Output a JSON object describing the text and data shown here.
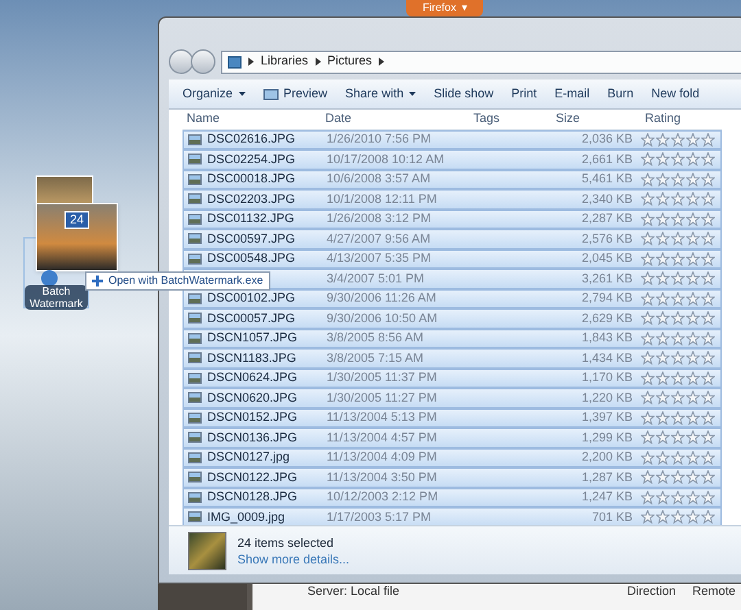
{
  "taskbar_button": {
    "label": "Firefox",
    "caret": "▾"
  },
  "breadcrumb": [
    "Libraries",
    "Pictures"
  ],
  "toolbar": [
    {
      "label": "Organize",
      "dropdown": true,
      "kind": "menu"
    },
    {
      "label": "Preview",
      "dropdown": false,
      "kind": "icon"
    },
    {
      "label": "Share with",
      "dropdown": true,
      "kind": "menu"
    },
    {
      "label": "Slide show",
      "dropdown": false,
      "kind": "plain"
    },
    {
      "label": "Print",
      "dropdown": false,
      "kind": "plain"
    },
    {
      "label": "E-mail",
      "dropdown": false,
      "kind": "plain"
    },
    {
      "label": "Burn",
      "dropdown": false,
      "kind": "plain"
    },
    {
      "label": "New fold",
      "dropdown": false,
      "kind": "plain"
    }
  ],
  "table": {
    "columns": [
      "Name",
      "Date",
      "Tags",
      "Size",
      "Rating"
    ],
    "rows": [
      {
        "name": "DSC02616.JPG",
        "date": "1/26/2010 7:56 PM",
        "size": "2,036 KB",
        "stars": 0,
        "selected": true
      },
      {
        "name": "DSC02254.JPG",
        "date": "10/17/2008 10:12 AM",
        "size": "2,661 KB",
        "stars": 0,
        "selected": true
      },
      {
        "name": "DSC00018.JPG",
        "date": "10/6/2008 3:57 AM",
        "size": "5,461 KB",
        "stars": 0,
        "selected": true
      },
      {
        "name": "DSC02203.JPG",
        "date": "10/1/2008 12:11 PM",
        "size": "2,340 KB",
        "stars": 0,
        "selected": true
      },
      {
        "name": "DSC01132.JPG",
        "date": "1/26/2008 3:12 PM",
        "size": "2,287 KB",
        "stars": 0,
        "selected": true
      },
      {
        "name": "DSC00597.JPG",
        "date": "4/27/2007 9:56 AM",
        "size": "2,576 KB",
        "stars": 0,
        "selected": true
      },
      {
        "name": "DSC00548.JPG",
        "date": "4/13/2007 5:35 PM",
        "size": "2,045 KB",
        "stars": 0,
        "selected": true
      },
      {
        "date": "3/4/2007 5:01 PM",
        "size": "3,261 KB",
        "stars": 0,
        "selected": true
      },
      {
        "name": "DSC00102.JPG",
        "date": "9/30/2006 11:26 AM",
        "size": "2,794 KB",
        "stars": 0,
        "selected": true
      },
      {
        "name": "DSC00057.JPG",
        "date": "9/30/2006 10:50 AM",
        "size": "2,629 KB",
        "stars": 0,
        "selected": true
      },
      {
        "name": "DSCN1057.JPG",
        "date": "3/8/2005 8:56 AM",
        "size": "1,843 KB",
        "stars": 0,
        "selected": true
      },
      {
        "name": "DSCN1183.JPG",
        "date": "3/8/2005 7:15 AM",
        "size": "1,434 KB",
        "stars": 0,
        "selected": true
      },
      {
        "name": "DSCN0624.JPG",
        "date": "1/30/2005 11:37 PM",
        "size": "1,170 KB",
        "stars": 0,
        "selected": true
      },
      {
        "name": "DSCN0620.JPG",
        "date": "1/30/2005 11:27 PM",
        "size": "1,220 KB",
        "stars": 0,
        "selected": true
      },
      {
        "name": "DSCN0152.JPG",
        "date": "11/13/2004 5:13 PM",
        "size": "1,397 KB",
        "stars": 0,
        "selected": true
      },
      {
        "name": "DSCN0136.JPG",
        "date": "11/13/2004 4:57 PM",
        "size": "1,299 KB",
        "stars": 0,
        "selected": true
      },
      {
        "name": "DSCN0127.jpg",
        "date": "11/13/2004 4:09 PM",
        "size": "2,200 KB",
        "stars": 0,
        "selected": true
      },
      {
        "name": "DSCN0122.JPG",
        "date": "11/13/2004 3:50 PM",
        "size": "1,287 KB",
        "stars": 0,
        "selected": true
      },
      {
        "name": "DSCN0128.JPG",
        "date": "10/12/2003 2:12 PM",
        "size": "1,247 KB",
        "stars": 0,
        "selected": true
      },
      {
        "name": "IMG_0009.jpg",
        "date": "1/17/2003 5:17 PM",
        "size": "701 KB",
        "stars": 0,
        "selected": true
      }
    ]
  },
  "details": {
    "summary": "24 items selected",
    "link": "Show more details..."
  },
  "desktop_icon": {
    "label": "Batch Watermark",
    "drag_count": "24"
  },
  "drag_tooltip": {
    "label": "Open with BatchWatermark.exe"
  },
  "background_app": {
    "left": "Server: Local file",
    "right": [
      "Direction",
      "Remote"
    ]
  }
}
